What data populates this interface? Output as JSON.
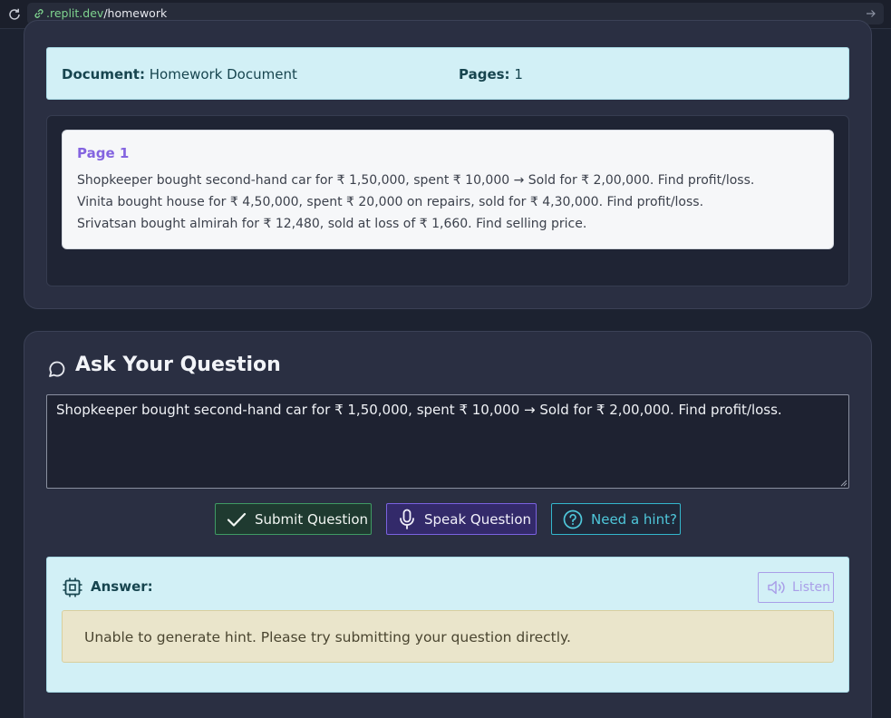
{
  "browser": {
    "url_host": ".replit.dev",
    "url_path": "/homework"
  },
  "document_info": {
    "doc_label": "Document:",
    "doc_value": "Homework Document",
    "pages_label": "Pages:",
    "pages_value": "1"
  },
  "page": {
    "title": "Page 1",
    "lines": [
      "Shopkeeper bought second-hand car for ₹ 1,50,000, spent ₹ 10,000 → Sold for ₹ 2,00,000. Find profit/loss.",
      "Vinita bought house for ₹ 4,50,000, spent ₹ 20,000 on repairs, sold for ₹ 4,30,000. Find profit/loss.",
      "Srivatsan bought almirah for ₹ 12,480, sold at loss of ₹ 1,660. Find selling price."
    ]
  },
  "question": {
    "heading": "Ask Your Question",
    "input_value": "Shopkeeper bought second-hand car for ₹ 1,50,000, spent ₹ 10,000 → Sold for ₹ 2,00,000. Find profit/loss.",
    "submit_label": "Submit Question",
    "speak_label": "Speak Question",
    "hint_label": "Need a hint?"
  },
  "answer": {
    "label": "Answer:",
    "listen_label": "Listen",
    "message": "Unable to generate hint. Please try submitting your question directly."
  },
  "colors": {
    "background": "#1c2230",
    "card": "#2a2f42",
    "info_panel": "#d2f0f6",
    "page_title": "#8464e0",
    "submit_border": "#3f9a64",
    "speak_border": "#7a62e0",
    "hint_border": "#33b6cc",
    "hint_message_bg": "#eae5cb"
  },
  "icons": [
    "reload-icon",
    "link-icon",
    "arrow-right-icon",
    "chat-bubble-icon",
    "check-icon",
    "microphone-icon",
    "help-circle-icon",
    "chip-icon",
    "volume-icon"
  ]
}
